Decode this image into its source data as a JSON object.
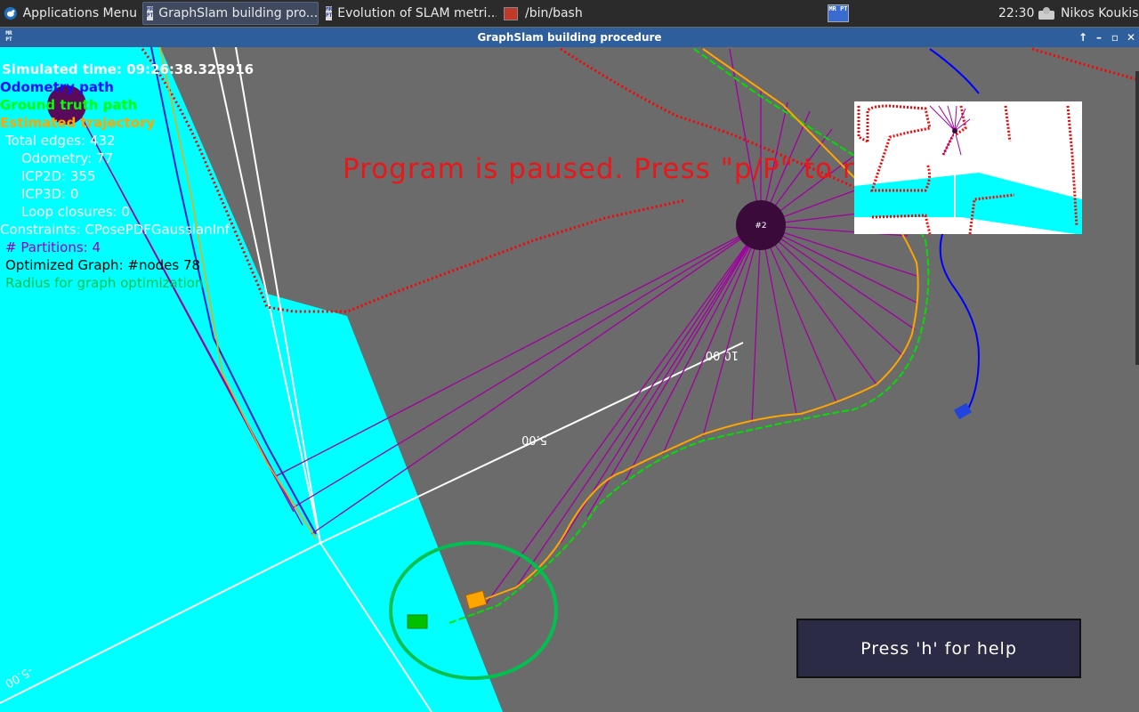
{
  "taskbar": {
    "apps_menu": "Applications Menu",
    "windows": [
      {
        "label": "GraphSlam building pro...",
        "icon": "mrpt-app-icon",
        "active": true
      },
      {
        "label": "Evolution of SLAM metri...",
        "icon": "mrpt-app-icon",
        "active": false
      },
      {
        "label": "/bin/bash",
        "icon": "terminal-icon",
        "active": false
      }
    ],
    "tray_icon_text": "MR PT",
    "clock": "22:30",
    "user": "Nikos Koukis"
  },
  "window": {
    "title": "GraphSlam building procedure",
    "app_icon_text": "MR PT"
  },
  "overlay": {
    "sim_time": "Simulated time: 09:26:38.323916",
    "odometry_path": "Odometry path",
    "ground_truth": "Ground truth path",
    "estimated_traj": "Estimated trajectory",
    "total_edges": "Total edges: 432",
    "odometry": "Odometry: 77",
    "icp2d": "ICP2D: 355",
    "icp3d": "ICP3D: 0",
    "loop_closures": "Loop closures: 0",
    "constraints": "Constraints: CPosePDFGaussianInf",
    "partitions": "# Partitions: 4",
    "optimized_graph": "Optimized Graph: #nodes 78",
    "radius": "Radius for graph optimization"
  },
  "paused_message": "Program is paused. Press \"p/P\" to resume.",
  "help_text": "Press 'h' for help",
  "scene": {
    "node_label": "#2",
    "axis_labels": [
      "10.00",
      "5.00",
      "-5.00"
    ],
    "colors": {
      "background": "#6b6b6b",
      "floor": "#00ffff",
      "odometry": "#0000ff",
      "ground_truth": "#00e000",
      "estimated": "#ffa500",
      "edges": "#a000a0",
      "laser": "#ff0000",
      "radius": "#00c050"
    }
  }
}
